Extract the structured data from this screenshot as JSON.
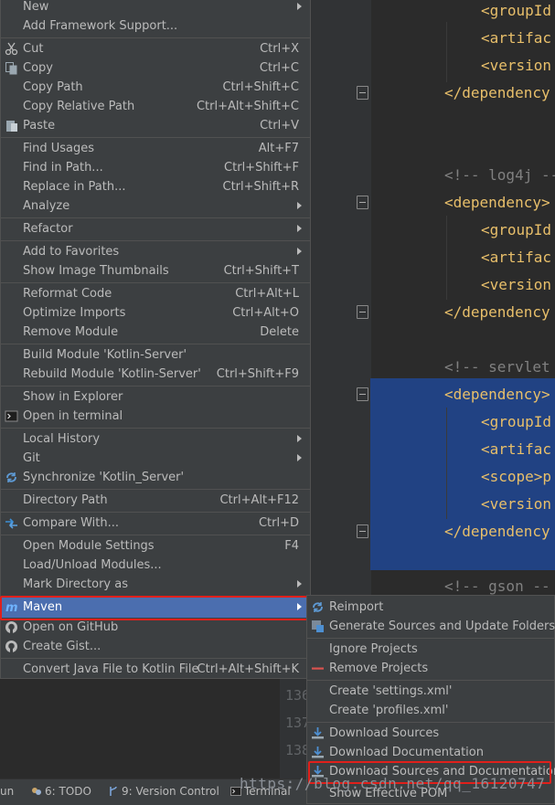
{
  "editor": {
    "code_lines": [
      {
        "text": "<groupId",
        "type": "tag",
        "indent": true
      },
      {
        "text": "<artifac",
        "type": "tag",
        "indent": true
      },
      {
        "text": "<version",
        "type": "tag",
        "indent": true
      },
      {
        "text": "</dependency",
        "type": "tag",
        "indent": false
      },
      {
        "text": "<!-- log4j --",
        "type": "comment",
        "indent": false
      },
      {
        "text": "<dependency>",
        "type": "tag",
        "indent": false
      },
      {
        "text": "<groupId",
        "type": "tag",
        "indent": true
      },
      {
        "text": "<artifac",
        "type": "tag",
        "indent": true
      },
      {
        "text": "<version",
        "type": "tag",
        "indent": true
      },
      {
        "text": "</dependency",
        "type": "tag",
        "indent": false
      },
      {
        "text": "<!-- servlet",
        "type": "comment",
        "indent": false
      },
      {
        "text": "<dependency>",
        "type": "tag",
        "indent": false
      },
      {
        "text": "<groupId",
        "type": "tag",
        "indent": true
      },
      {
        "text": "<artifac",
        "type": "tag",
        "indent": true
      },
      {
        "text": "<scope>p",
        "type": "tag",
        "indent": true
      },
      {
        "text": "<version",
        "type": "tag",
        "indent": true
      },
      {
        "text": "</dependency",
        "type": "tag",
        "indent": false
      },
      {
        "text": "<!-- gson --",
        "type": "comment",
        "indent": false
      }
    ],
    "line_numbers": [
      "136",
      "137",
      "138"
    ]
  },
  "main_menu": {
    "items": [
      {
        "label": "New",
        "shortcut": "",
        "submenu": true,
        "icon": ""
      },
      {
        "label": "Add Framework Support...",
        "shortcut": "",
        "submenu": false,
        "icon": ""
      },
      {
        "label": "Cut",
        "shortcut": "Ctrl+X",
        "submenu": false,
        "icon": "scissors-icon"
      },
      {
        "label": "Copy",
        "shortcut": "Ctrl+C",
        "submenu": false,
        "icon": "copy-icon"
      },
      {
        "label": "Copy Path",
        "shortcut": "Ctrl+Shift+C",
        "submenu": false,
        "icon": ""
      },
      {
        "label": "Copy Relative Path",
        "shortcut": "Ctrl+Alt+Shift+C",
        "submenu": false,
        "icon": ""
      },
      {
        "label": "Paste",
        "shortcut": "Ctrl+V",
        "submenu": false,
        "icon": "paste-icon"
      },
      {
        "label": "Find Usages",
        "shortcut": "Alt+F7",
        "submenu": false,
        "icon": ""
      },
      {
        "label": "Find in Path...",
        "shortcut": "Ctrl+Shift+F",
        "submenu": false,
        "icon": ""
      },
      {
        "label": "Replace in Path...",
        "shortcut": "Ctrl+Shift+R",
        "submenu": false,
        "icon": ""
      },
      {
        "label": "Analyze",
        "shortcut": "",
        "submenu": true,
        "icon": ""
      },
      {
        "label": "Refactor",
        "shortcut": "",
        "submenu": true,
        "icon": ""
      },
      {
        "label": "Add to Favorites",
        "shortcut": "",
        "submenu": true,
        "icon": ""
      },
      {
        "label": "Show Image Thumbnails",
        "shortcut": "Ctrl+Shift+T",
        "submenu": false,
        "icon": ""
      },
      {
        "label": "Reformat Code",
        "shortcut": "Ctrl+Alt+L",
        "submenu": false,
        "icon": ""
      },
      {
        "label": "Optimize Imports",
        "shortcut": "Ctrl+Alt+O",
        "submenu": false,
        "icon": ""
      },
      {
        "label": "Remove Module",
        "shortcut": "Delete",
        "submenu": false,
        "icon": ""
      },
      {
        "label": "Build Module 'Kotlin-Server'",
        "shortcut": "",
        "submenu": false,
        "icon": ""
      },
      {
        "label": "Rebuild Module 'Kotlin-Server'",
        "shortcut": "Ctrl+Shift+F9",
        "submenu": false,
        "icon": ""
      },
      {
        "label": "Show in Explorer",
        "shortcut": "",
        "submenu": false,
        "icon": ""
      },
      {
        "label": "Open in terminal",
        "shortcut": "",
        "submenu": false,
        "icon": "terminal-icon"
      },
      {
        "label": "Local History",
        "shortcut": "",
        "submenu": true,
        "icon": ""
      },
      {
        "label": "Git",
        "shortcut": "",
        "submenu": true,
        "icon": ""
      },
      {
        "label": "Synchronize 'Kotlin_Server'",
        "shortcut": "",
        "submenu": false,
        "icon": "sync-icon"
      },
      {
        "label": "Directory Path",
        "shortcut": "Ctrl+Alt+F12",
        "submenu": false,
        "icon": ""
      },
      {
        "label": "Compare With...",
        "shortcut": "Ctrl+D",
        "submenu": false,
        "icon": "compare-icon"
      },
      {
        "label": "Open Module Settings",
        "shortcut": "F4",
        "submenu": false,
        "icon": ""
      },
      {
        "label": "Load/Unload Modules...",
        "shortcut": "",
        "submenu": false,
        "icon": ""
      },
      {
        "label": "Mark Directory as",
        "shortcut": "",
        "submenu": true,
        "icon": ""
      },
      {
        "label": "Maven",
        "shortcut": "",
        "submenu": true,
        "icon": "maven-icon"
      },
      {
        "label": "Open on GitHub",
        "shortcut": "",
        "submenu": false,
        "icon": "github-icon"
      },
      {
        "label": "Create Gist...",
        "shortcut": "",
        "submenu": false,
        "icon": "github-icon"
      },
      {
        "label": "Convert Java File to Kotlin File",
        "shortcut": "Ctrl+Alt+Shift+K",
        "submenu": false,
        "icon": ""
      }
    ]
  },
  "maven_menu": {
    "items": [
      {
        "label": "Reimport",
        "icon": "reimport-icon"
      },
      {
        "label": "Generate Sources and Update Folders",
        "icon": "generate-sources-icon"
      },
      {
        "label": "Ignore Projects",
        "icon": ""
      },
      {
        "label": "Remove Projects",
        "icon": "remove-icon"
      },
      {
        "label": "Create 'settings.xml'",
        "icon": ""
      },
      {
        "label": "Create 'profiles.xml'",
        "icon": ""
      },
      {
        "label": "Download Sources",
        "icon": "download-icon"
      },
      {
        "label": "Download Documentation",
        "icon": "download-icon"
      },
      {
        "label": "Download Sources and Documentation",
        "icon": "download-icon"
      },
      {
        "label": "Show Effective POM",
        "icon": ""
      }
    ]
  },
  "statusbar": {
    "run_label": "un",
    "todo_label": "6: TODO",
    "vcs_label": "9: Version Control",
    "terminal_label": "Terminal"
  },
  "watermark": "https://blog.csdn.net/qq_16120747",
  "colors": {
    "highlight": "#4b6eaf",
    "selection": "#214283",
    "annotation_box": "#e0201b",
    "menu_bg": "#3c3f41"
  }
}
